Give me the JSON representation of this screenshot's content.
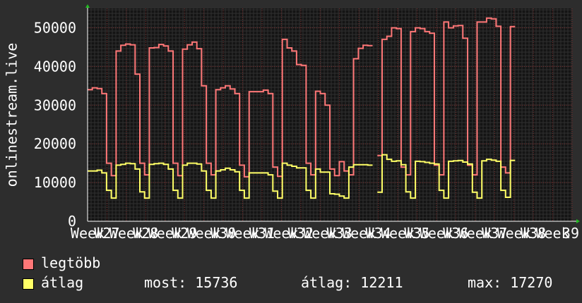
{
  "chart_data": {
    "type": "line",
    "ylabel": "onlinestream.live",
    "ylim": [
      0,
      55000
    ],
    "yticks": [
      0,
      10000,
      20000,
      30000,
      40000,
      50000
    ],
    "xlabels": [
      "Week",
      "W27",
      "Week",
      "W28",
      "Week",
      "W29",
      "Week",
      "W30",
      "Week",
      "W31",
      "Week",
      "W32",
      "Week",
      "W33",
      "Week",
      "W34",
      "Week",
      "W35",
      "Week",
      "W36",
      "Week",
      "W37",
      "Week",
      "W38",
      "Week",
      "39"
    ],
    "x_range": [
      0,
      102
    ],
    "series": [
      {
        "name": "legtöbb",
        "color": "#ff7777",
        "values": [
          34000,
          34500,
          34300,
          33000,
          15000,
          11800,
          44000,
          45500,
          45800,
          45600,
          38000,
          15000,
          12000,
          44800,
          44900,
          45700,
          45300,
          44000,
          15000,
          11800,
          44500,
          45600,
          46300,
          44600,
          35000,
          15000,
          12000,
          34000,
          34500,
          35000,
          34200,
          33000,
          14500,
          11500,
          33500,
          33500,
          33500,
          33900,
          33000,
          14000,
          11600,
          47000,
          44800,
          44000,
          40500,
          40300,
          15000,
          12000,
          33600,
          33000,
          30000,
          13500,
          11800,
          15400,
          13000,
          12000,
          42000,
          44700,
          45500,
          45400,
          null,
          17000,
          47000,
          47800,
          50000,
          49800,
          14000,
          12000,
          49000,
          50000,
          49800,
          49000,
          48600,
          14500,
          12000,
          51500,
          50000,
          50500,
          50600,
          47300,
          14500,
          12000,
          51500,
          51500,
          52500,
          52300,
          50400,
          14000,
          12500,
          50300
        ]
      },
      {
        "name": "átlag",
        "color": "#ffff66",
        "values": [
          13000,
          13000,
          13200,
          12500,
          8000,
          6000,
          14500,
          14700,
          15000,
          14900,
          13500,
          7600,
          6000,
          14700,
          14900,
          15000,
          14700,
          13500,
          8000,
          6000,
          14500,
          15000,
          15000,
          14800,
          13000,
          8000,
          6000,
          13000,
          13300,
          13700,
          13300,
          12800,
          8000,
          6000,
          12500,
          12500,
          12500,
          12500,
          12000,
          7800,
          6000,
          15000,
          14500,
          14200,
          13800,
          13800,
          8000,
          6000,
          13500,
          12700,
          12700,
          7100,
          7000,
          6500,
          6000,
          14000,
          14600,
          14600,
          14600,
          14500,
          null,
          7500,
          17200,
          16000,
          15500,
          15600,
          14600,
          7600,
          6000,
          15500,
          15400,
          15200,
          15000,
          14800,
          8000,
          6000,
          15500,
          15600,
          15700,
          15300,
          14800,
          7500,
          6000,
          15600,
          16000,
          15800,
          15500,
          8000,
          6200,
          15736
        ]
      }
    ]
  },
  "legend": {
    "max_label": "legtöbb",
    "avg_label": "átlag",
    "stats": {
      "current": "most: 15736",
      "average": "átlag: 12211",
      "maximum": "max: 17270"
    }
  }
}
